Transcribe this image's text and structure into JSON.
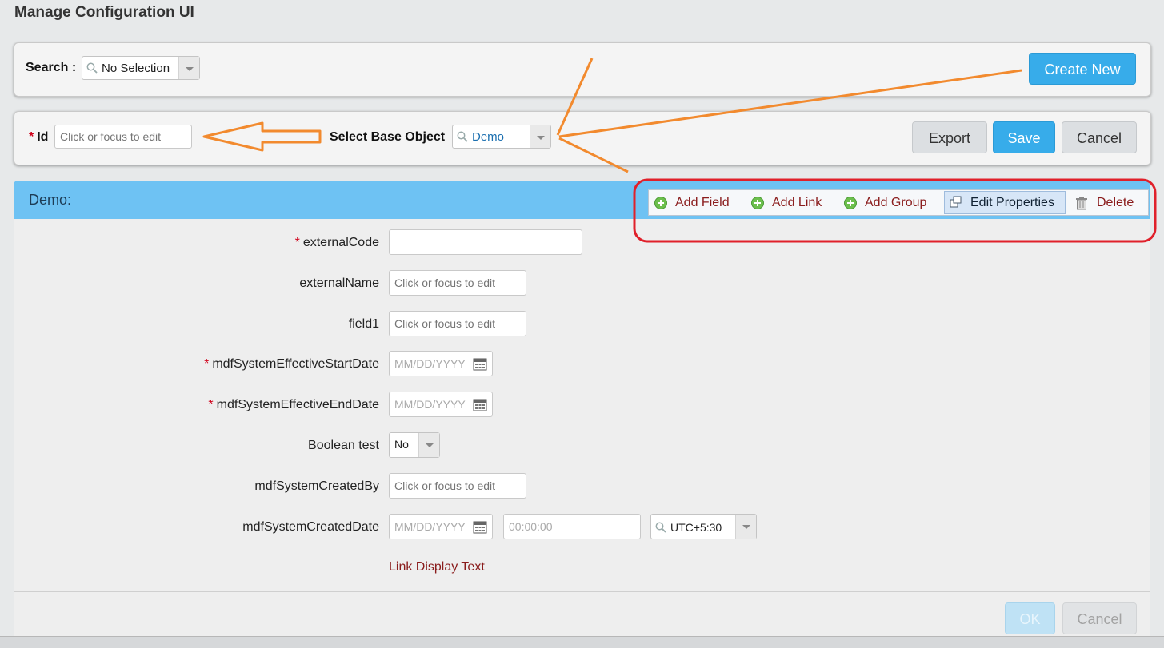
{
  "page": {
    "title": "Manage Configuration UI"
  },
  "search": {
    "label": "Search :",
    "value": "No Selection",
    "create_new": "Create New"
  },
  "object_bar": {
    "id_label": "Id",
    "id_placeholder": "Click or focus to edit",
    "base_object_label": "Select Base Object",
    "base_object_value": "Demo",
    "export": "Export",
    "save": "Save",
    "cancel": "Cancel"
  },
  "demo": {
    "title": "Demo:",
    "toolbar": {
      "add_field": "Add Field",
      "add_link": "Add Link",
      "add_group": "Add Group",
      "edit_properties": "Edit Properties",
      "delete": "Delete"
    },
    "fields": {
      "externalCode": {
        "label": "externalCode",
        "required": true,
        "value": ""
      },
      "externalName": {
        "label": "externalName",
        "placeholder": "Click or focus to edit"
      },
      "field1": {
        "label": "field1",
        "placeholder": "Click or focus to edit"
      },
      "start_date": {
        "label": "mdfSystemEffectiveStartDate",
        "required": true,
        "placeholder": "MM/DD/YYYY"
      },
      "end_date": {
        "label": "mdfSystemEffectiveEndDate",
        "required": true,
        "placeholder": "MM/DD/YYYY"
      },
      "boolean_test": {
        "label": "Boolean test",
        "value": "No"
      },
      "created_by": {
        "label": "mdfSystemCreatedBy",
        "placeholder": "Click or focus to edit"
      },
      "created_date": {
        "label": "mdfSystemCreatedDate",
        "date_placeholder": "MM/DD/YYYY",
        "time_value": "00:00:00",
        "timezone": "UTC+5:30"
      }
    },
    "link_display_text": "Link Display Text",
    "footer": {
      "ok": "OK",
      "cancel": "Cancel"
    }
  },
  "colors": {
    "accent_blue": "#37acea",
    "header_blue": "#6ec2f3",
    "link_red": "#8a1c1c",
    "annotation_orange": "#f28a2e",
    "annotation_red": "#e0202a"
  }
}
